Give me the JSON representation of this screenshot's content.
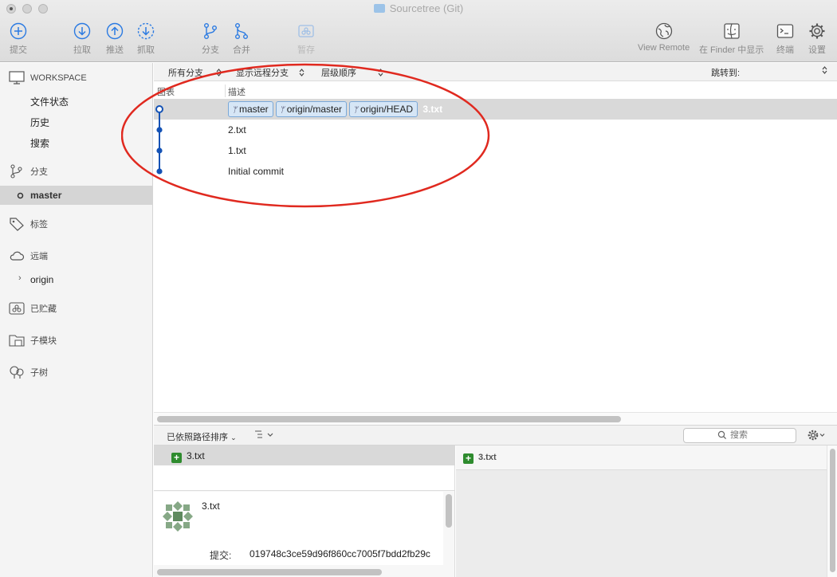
{
  "window": {
    "title": "Sourcetree (Git)"
  },
  "toolbar": {
    "commit": "提交",
    "pull": "拉取",
    "push": "推送",
    "fetch": "抓取",
    "branch": "分支",
    "merge": "合并",
    "stash": "暂存",
    "view_remote": "View Remote",
    "show_in_finder": "在 Finder 中显示",
    "terminal": "终端",
    "settings": "设置"
  },
  "sidebar": {
    "workspace": "WORKSPACE",
    "file_status": "文件状态",
    "history": "历史",
    "search": "搜索",
    "branches": "分支",
    "current_branch": "master",
    "tags": "标签",
    "remotes": "远端",
    "remote_origin": "origin",
    "stashes": "已贮藏",
    "submodules": "子模块",
    "subtrees": "子树"
  },
  "filter": {
    "all_branches": "所有分支",
    "show_remote": "显示远程分支",
    "order": "层级顺序",
    "jump_to": "跳转到:"
  },
  "columns": {
    "graph": "图表",
    "description": "描述"
  },
  "commits": [
    {
      "tags": [
        "master",
        "origin/master",
        "origin/HEAD"
      ],
      "message": "3.txt"
    },
    {
      "message": "2.txt"
    },
    {
      "message": "1.txt"
    },
    {
      "message": "Initial commit"
    }
  ],
  "bottom": {
    "sort_label": "已依照路径排序",
    "search_placeholder": "搜索",
    "file": "3.txt"
  },
  "commit_detail": {
    "message": "3.txt",
    "commit_label": "提交:",
    "hash": "019748c3ce59d96f860cc7005f7bdd2fb29c"
  },
  "diff": {
    "file": "3.txt"
  },
  "colors": {
    "accent": "#0f5fbf",
    "annotation": "#e0291f",
    "add": "#2e8b2e"
  }
}
